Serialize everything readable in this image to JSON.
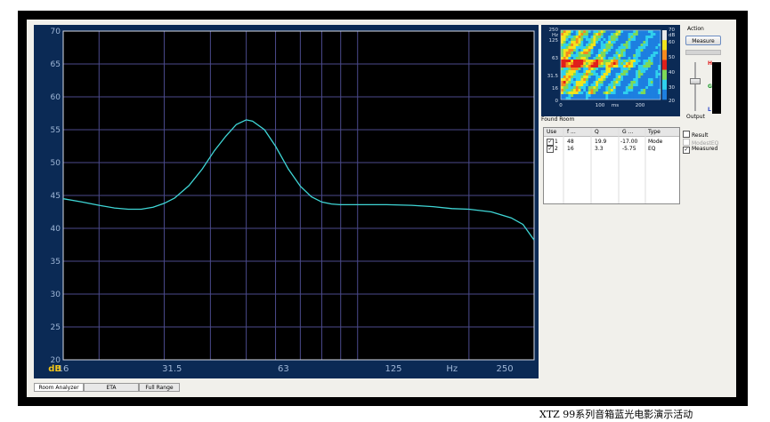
{
  "chart_data": {
    "type": "line",
    "xlabel": "Hz",
    "ylabel": "dB",
    "xscale": "log",
    "xlim": [
      16,
      300
    ],
    "ylim": [
      20,
      70
    ],
    "grid": true,
    "yticks": [
      "70",
      "65",
      "60",
      "55",
      "50",
      "45",
      "40",
      "35",
      "30",
      "25",
      "20"
    ],
    "xticks": [
      "16",
      "31.5",
      "63",
      "125",
      "250"
    ],
    "series": [
      {
        "color": "#3fd6d6",
        "x": [
          16,
          18,
          20,
          22,
          24,
          26,
          28,
          30,
          32,
          35,
          38,
          41,
          44,
          47,
          50,
          52,
          56,
          60,
          65,
          70,
          75,
          80,
          85,
          90,
          100,
          120,
          140,
          160,
          180,
          200,
          230,
          260,
          280,
          300
        ],
        "y": [
          44.5,
          44.0,
          43.5,
          43.1,
          42.9,
          42.9,
          43.2,
          43.8,
          44.6,
          46.5,
          49.0,
          51.8,
          54.0,
          55.8,
          56.5,
          56.3,
          55.0,
          52.5,
          49.0,
          46.4,
          44.8,
          44.0,
          43.7,
          43.6,
          43.6,
          43.6,
          43.5,
          43.3,
          43.0,
          42.9,
          42.5,
          41.6,
          40.6,
          38.2
        ]
      }
    ]
  },
  "spectrogram": {
    "yticks": [
      "250",
      "Hz",
      "125",
      "63",
      "31.5",
      "16",
      "0"
    ],
    "xticks": [
      "0",
      "100",
      "ms",
      "200"
    ],
    "scale_ticks": [
      "70",
      "dB",
      "60",
      "50",
      "40",
      "30",
      "20"
    ]
  },
  "found_room": {
    "title": "Found Room",
    "headers": [
      "Use",
      "f ...",
      "Q",
      "G ...",
      "Type"
    ],
    "rows": [
      {
        "checked": true,
        "id": "1",
        "f": "48",
        "q": "19.9",
        "g": "-17.00",
        "type": "Mode"
      },
      {
        "checked": true,
        "id": "2",
        "f": "16",
        "q": "3.3",
        "g": "-5.75",
        "type": "EQ"
      }
    ]
  },
  "action": {
    "label": "Action",
    "measure_button": "Measure",
    "output_label": "Output",
    "meter_labels": {
      "high": "H",
      "good": "G",
      "low": "L"
    }
  },
  "options": [
    {
      "label": "Result",
      "checked": false,
      "enabled": true
    },
    {
      "label": "ModestEQ",
      "checked": false,
      "enabled": false
    },
    {
      "label": "Measured",
      "checked": true,
      "enabled": true
    }
  ],
  "tabs": [
    {
      "label": "Room Analyzer",
      "active": true
    },
    {
      "label": "ETA",
      "active": false
    },
    {
      "label": "Full Range",
      "active": false
    }
  ],
  "caption": "XTZ 99系列音箱蓝光电影演示活动"
}
